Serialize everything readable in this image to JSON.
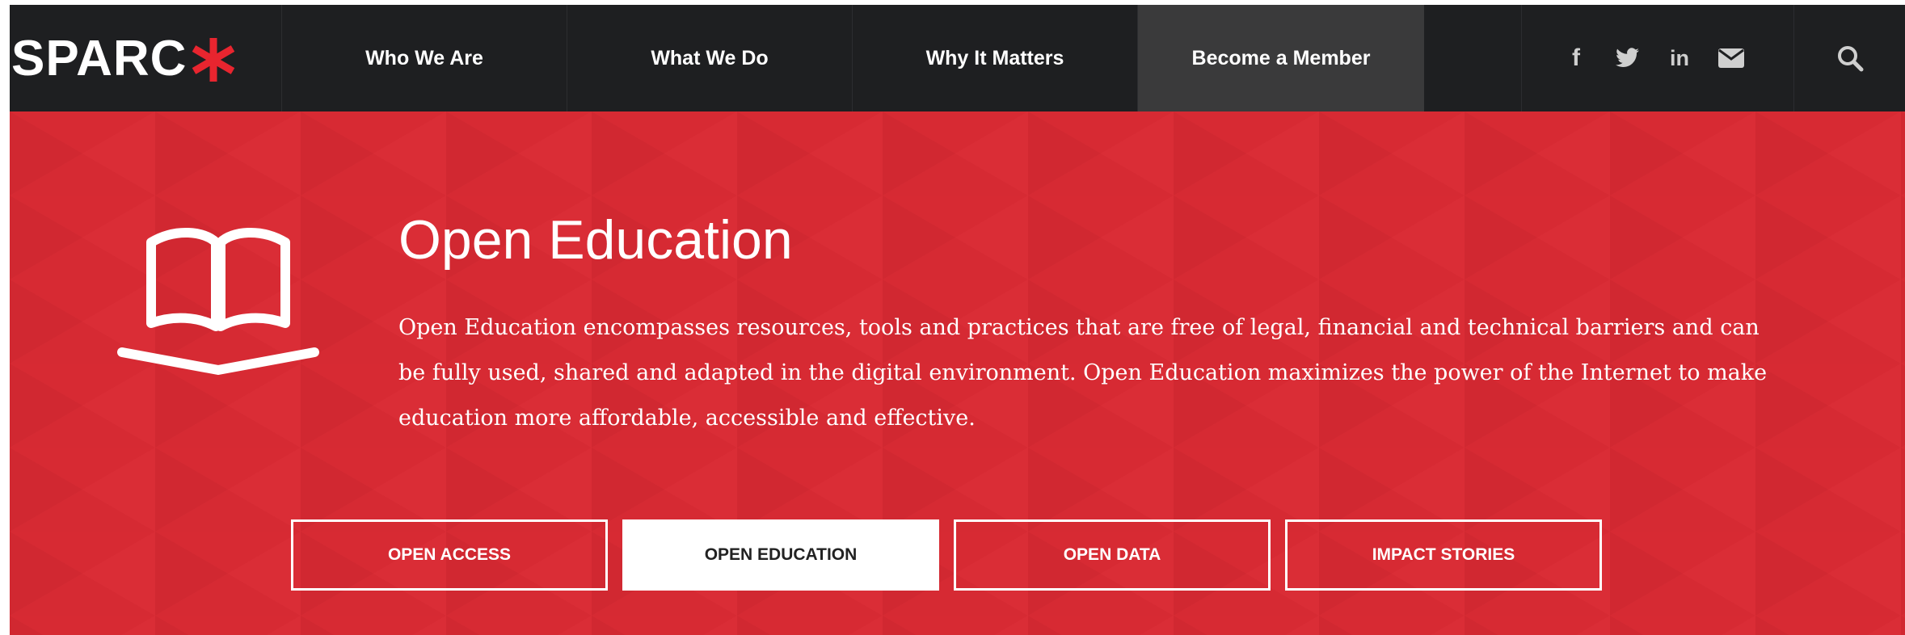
{
  "header": {
    "logo_text": "SPARC",
    "nav": [
      {
        "label": "Who We Are"
      },
      {
        "label": "What We Do"
      },
      {
        "label": "Why It Matters"
      },
      {
        "label": "Become a Member"
      }
    ],
    "social_icons": [
      "facebook-icon",
      "twitter-icon",
      "linkedin-icon",
      "email-icon"
    ],
    "social_labels": {
      "facebook": "f",
      "linkedin": "in"
    },
    "search_icon": "search-icon"
  },
  "hero": {
    "title": "Open Education",
    "description": "Open Education encompasses resources, tools and practices that are free of legal, financial and technical barriers and can be fully used, shared and adapted in the digital environment. Open Education maximizes the power of the Internet to make education more affordable, accessible and effective.",
    "icon": "open-book-icon",
    "tabs": [
      {
        "label": "OPEN ACCESS",
        "active": false
      },
      {
        "label": "OPEN EDUCATION",
        "active": true
      },
      {
        "label": "OPEN DATA",
        "active": false
      },
      {
        "label": "IMPACT STORIES",
        "active": false
      }
    ]
  },
  "colors": {
    "nav_bg": "#1e1f21",
    "nav_active_bg": "#3a3a3b",
    "brand_red": "#d72a33",
    "logo_star": "#e8252f"
  }
}
